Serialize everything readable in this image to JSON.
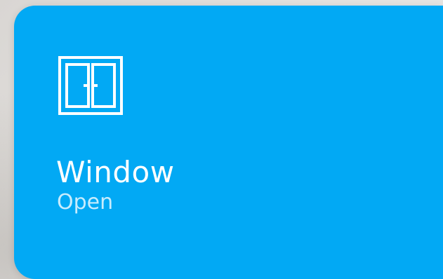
{
  "tile": {
    "title": "Window",
    "state": "Open",
    "icon": "window-icon",
    "color": "#02a9f4"
  }
}
